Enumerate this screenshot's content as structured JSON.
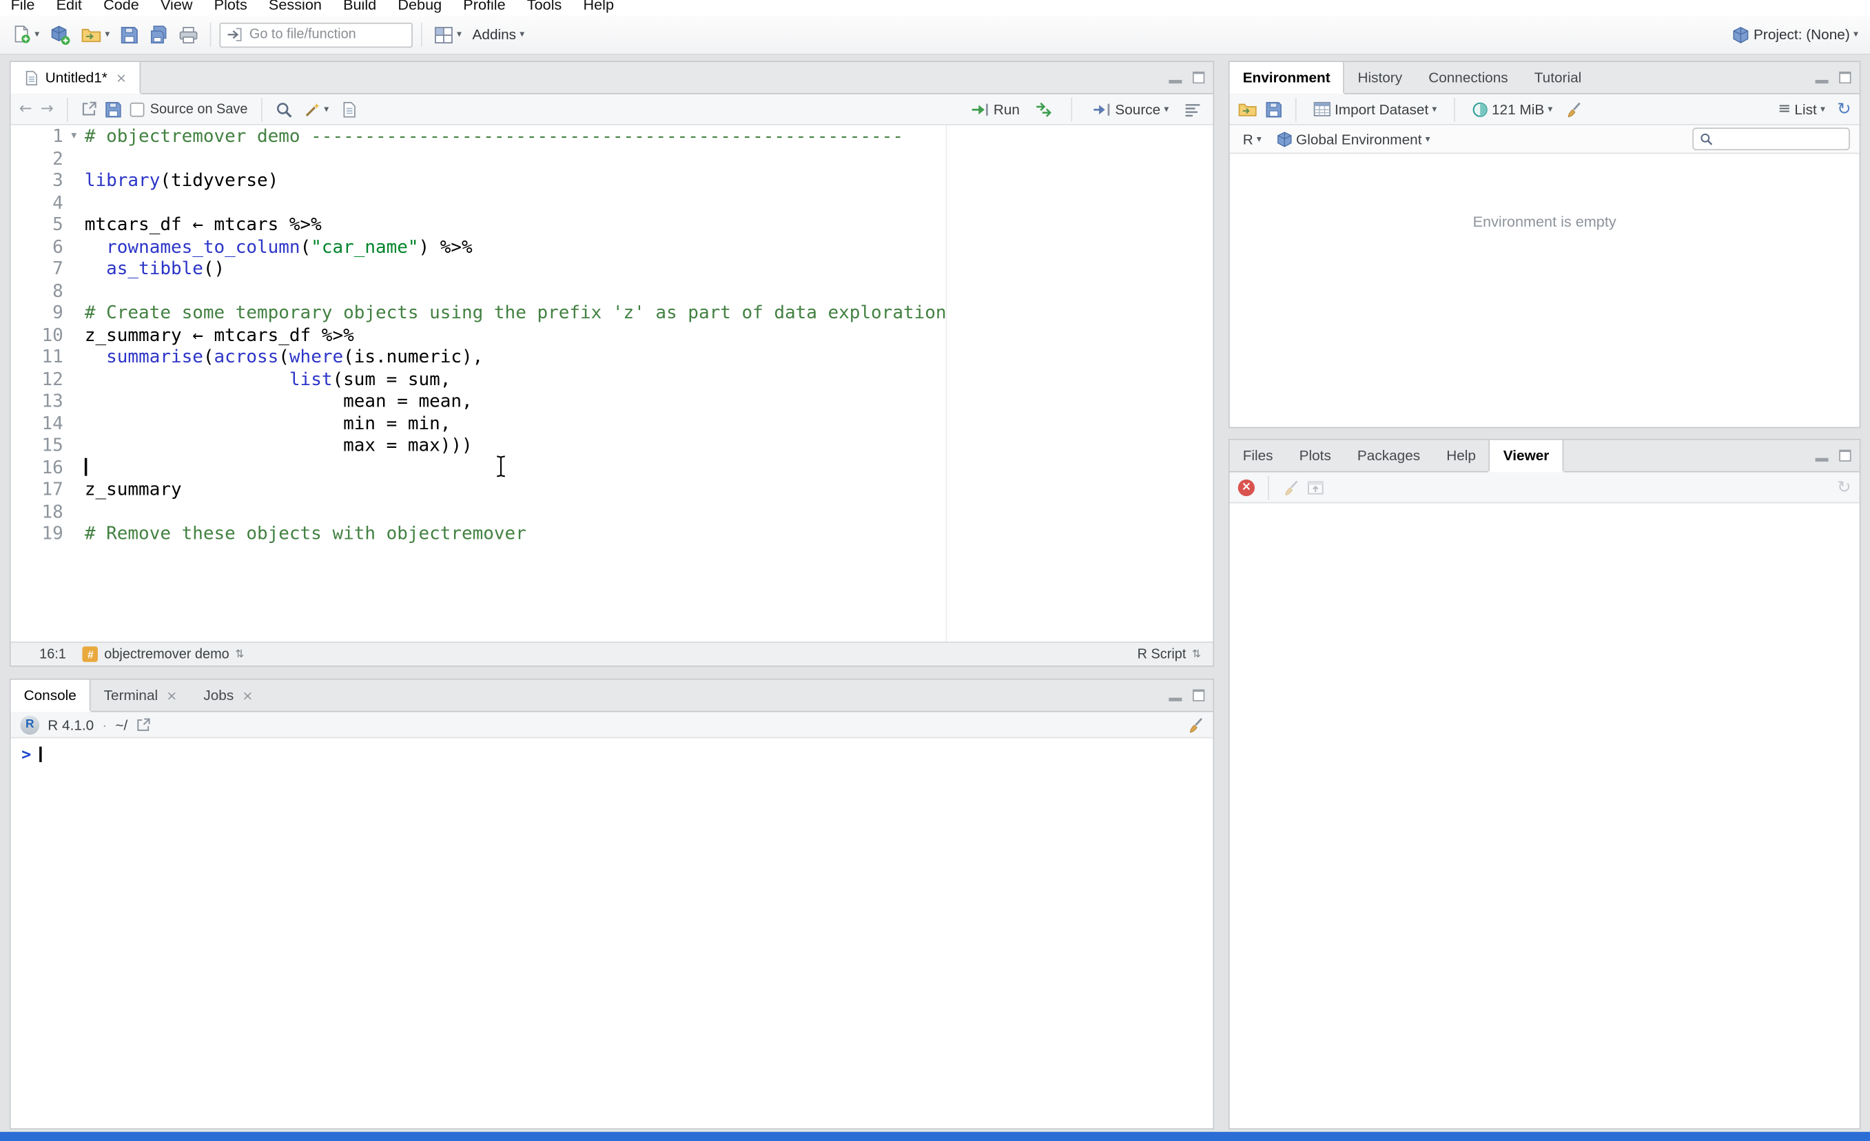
{
  "window": {
    "taskbar_color": "#2a6dd5"
  },
  "icons": {
    "dropdown": "▾",
    "updown": "⇅",
    "close": "×",
    "back": "←",
    "forward": "→",
    "refresh": "↻",
    "list": "≡",
    "fold": "▾",
    "hash": "#",
    "r_logo": "R",
    "popout": "↗"
  },
  "menu": {
    "items": [
      "File",
      "Edit",
      "Code",
      "View",
      "Plots",
      "Session",
      "Build",
      "Debug",
      "Profile",
      "Tools",
      "Help"
    ]
  },
  "toolbar": {
    "goto_placeholder": "Go to file/function",
    "addins_label": "Addins",
    "project_label": "Project: (None)"
  },
  "source_pane": {
    "tab_title": "Untitled1*",
    "toolbar": {
      "source_on_save": "Source on Save",
      "run_label": "Run",
      "source_label": "Source"
    },
    "status": {
      "position": "16:1",
      "section": "objectremover demo",
      "doc_type": "R Script"
    },
    "code": {
      "lines": [
        {
          "n": 1,
          "fold": true,
          "segs": [
            {
              "t": "# objectremover demo -------------------------------------------------------",
              "c": "comment"
            }
          ]
        },
        {
          "n": 2,
          "segs": []
        },
        {
          "n": 3,
          "segs": [
            {
              "t": "library",
              "c": "fn"
            },
            {
              "t": "(tidyverse)",
              "c": "plain"
            }
          ]
        },
        {
          "n": 4,
          "segs": []
        },
        {
          "n": 5,
          "segs": [
            {
              "t": "mtcars_df ← mtcars %>%",
              "c": "plain"
            }
          ]
        },
        {
          "n": 6,
          "segs": [
            {
              "t": "  ",
              "c": "plain"
            },
            {
              "t": "rownames_to_column",
              "c": "fn"
            },
            {
              "t": "(",
              "c": "plain"
            },
            {
              "t": "\"car_name\"",
              "c": "str"
            },
            {
              "t": ") %>%",
              "c": "plain"
            }
          ]
        },
        {
          "n": 7,
          "segs": [
            {
              "t": "  ",
              "c": "plain"
            },
            {
              "t": "as_tibble",
              "c": "fn"
            },
            {
              "t": "()",
              "c": "plain"
            }
          ]
        },
        {
          "n": 8,
          "segs": []
        },
        {
          "n": 9,
          "segs": [
            {
              "t": "# Create some temporary objects using the prefix 'z' as part of data exploration",
              "c": "comment"
            }
          ]
        },
        {
          "n": 10,
          "segs": [
            {
              "t": "z_summary ← mtcars_df %>%",
              "c": "plain"
            }
          ]
        },
        {
          "n": 11,
          "segs": [
            {
              "t": "  ",
              "c": "plain"
            },
            {
              "t": "summarise",
              "c": "fn"
            },
            {
              "t": "(",
              "c": "plain"
            },
            {
              "t": "across",
              "c": "fn"
            },
            {
              "t": "(",
              "c": "plain"
            },
            {
              "t": "where",
              "c": "fn"
            },
            {
              "t": "(is.numeric),",
              "c": "plain"
            }
          ]
        },
        {
          "n": 12,
          "segs": [
            {
              "t": "                   ",
              "c": "plain"
            },
            {
              "t": "list",
              "c": "fn"
            },
            {
              "t": "(sum = sum,",
              "c": "plain"
            }
          ]
        },
        {
          "n": 13,
          "segs": [
            {
              "t": "                        mean = mean,",
              "c": "plain"
            }
          ]
        },
        {
          "n": 14,
          "segs": [
            {
              "t": "                        min = min,",
              "c": "plain"
            }
          ]
        },
        {
          "n": 15,
          "segs": [
            {
              "t": "                        max = max)))",
              "c": "plain"
            }
          ]
        },
        {
          "n": 16,
          "caret": true,
          "segs": []
        },
        {
          "n": 17,
          "segs": [
            {
              "t": "z_summary",
              "c": "plain"
            }
          ]
        },
        {
          "n": 18,
          "segs": []
        },
        {
          "n": 19,
          "segs": [
            {
              "t": "# Remove these objects with objectremover",
              "c": "comment"
            }
          ]
        }
      ]
    }
  },
  "console_pane": {
    "tabs": [
      {
        "label": "Console",
        "active": true
      },
      {
        "label": "Terminal",
        "closable": true
      },
      {
        "label": "Jobs",
        "closable": true
      }
    ],
    "header": {
      "runtime": "R 4.1.0",
      "separator": "·",
      "path": "~/"
    },
    "prompt": ">"
  },
  "environment_pane": {
    "tabs": [
      {
        "label": "Environment",
        "active": true
      },
      {
        "label": "History"
      },
      {
        "label": "Connections"
      },
      {
        "label": "Tutorial"
      }
    ],
    "toolbar": {
      "import_label": "Import Dataset",
      "memory_label": "121 MiB",
      "list_label": "List"
    },
    "row2": {
      "language": "R",
      "scope": "Global Environment"
    },
    "empty_text": "Environment is empty"
  },
  "viewer_pane": {
    "tabs": [
      {
        "label": "Files"
      },
      {
        "label": "Plots"
      },
      {
        "label": "Packages"
      },
      {
        "label": "Help"
      },
      {
        "label": "Viewer",
        "active": true
      }
    ]
  },
  "code_colors": {
    "plain": "#000000",
    "comment": "#428141",
    "string": "#00842b",
    "function": "#2c35c7",
    "prompt": "#1d45cc"
  }
}
